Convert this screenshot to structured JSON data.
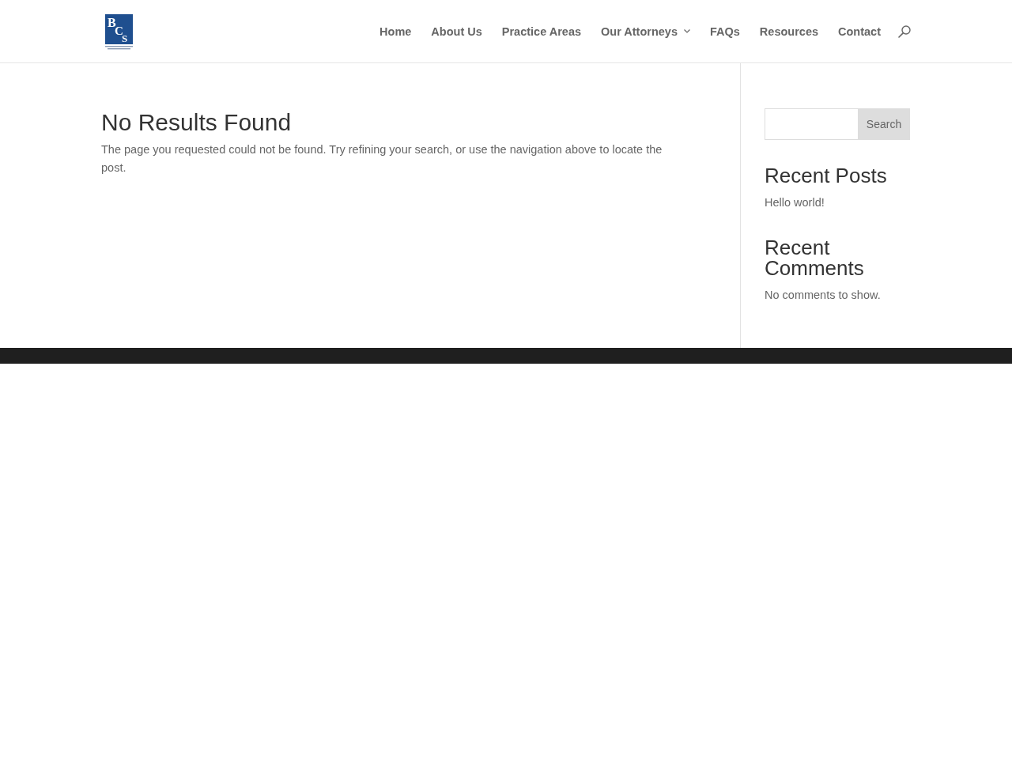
{
  "header": {
    "logo": {
      "letters": [
        "B",
        "C",
        "S"
      ]
    },
    "nav": [
      {
        "label": "Home",
        "has_submenu": false
      },
      {
        "label": "About Us",
        "has_submenu": false
      },
      {
        "label": "Practice Areas",
        "has_submenu": false
      },
      {
        "label": "Our Attorneys",
        "has_submenu": true
      },
      {
        "label": "FAQs",
        "has_submenu": false
      },
      {
        "label": "Resources",
        "has_submenu": false
      },
      {
        "label": "Contact",
        "has_submenu": false
      }
    ]
  },
  "main": {
    "title": "No Results Found",
    "message": "The page you requested could not be found. Try refining your search, or use the navigation above to locate the post."
  },
  "sidebar": {
    "search": {
      "button": "Search"
    },
    "widgets": [
      {
        "title": "Recent Posts",
        "links": [
          "Hello world!"
        ]
      },
      {
        "title": "Recent Comments",
        "note": "No comments to show."
      }
    ]
  }
}
